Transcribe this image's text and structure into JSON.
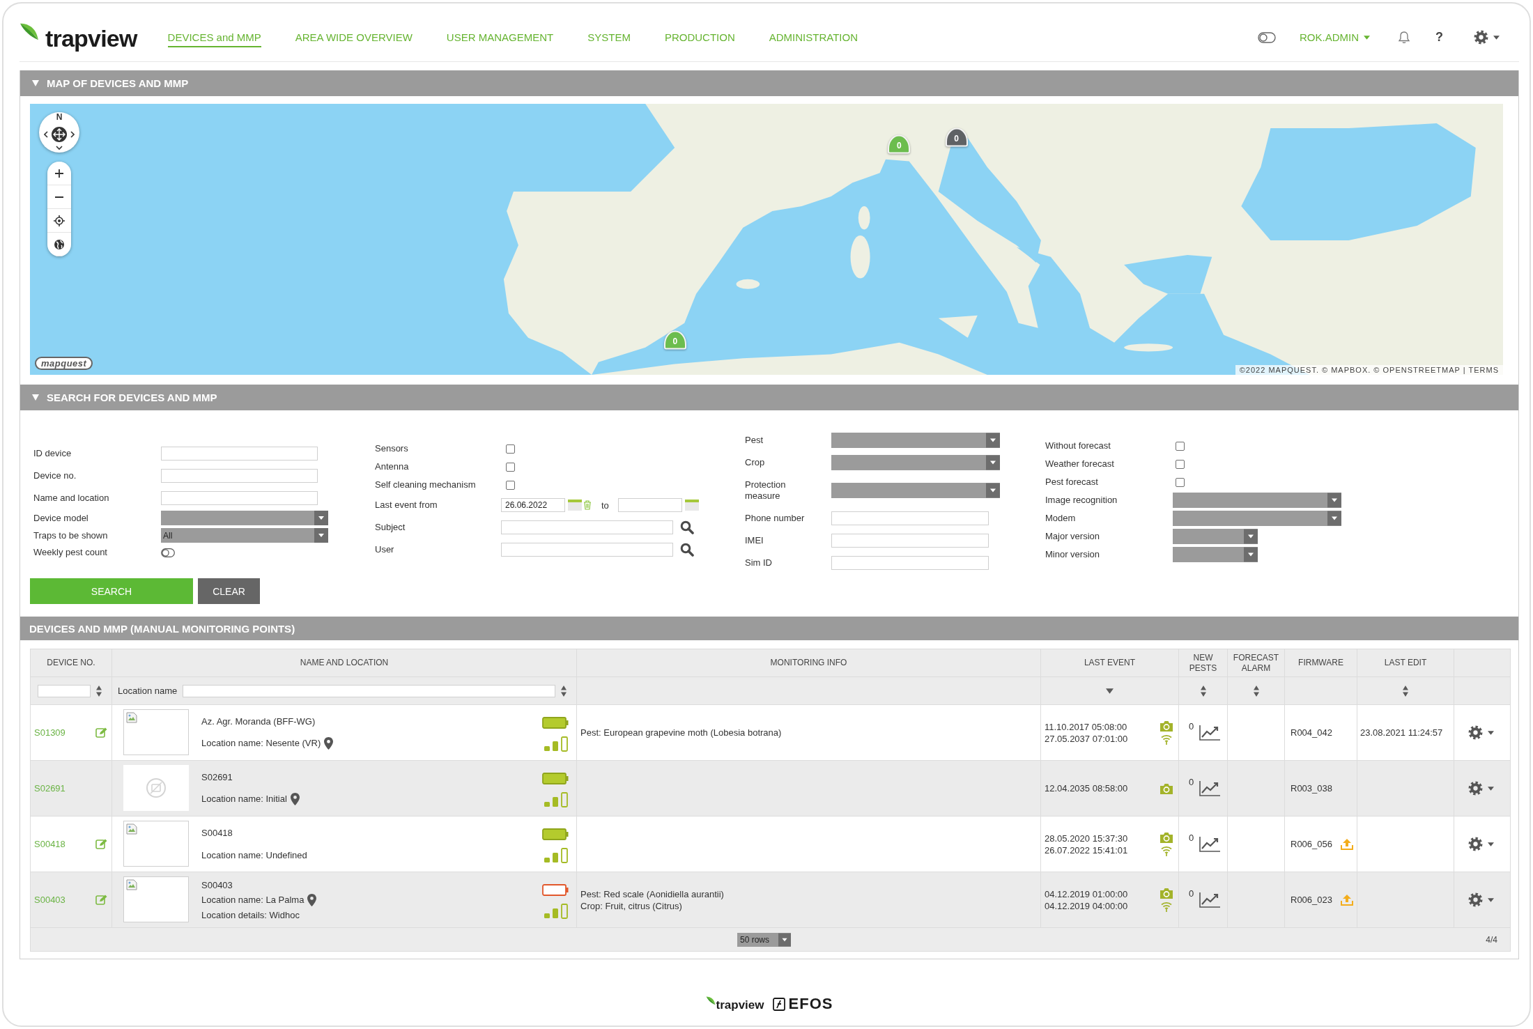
{
  "header": {
    "logo": "trapview",
    "nav": [
      {
        "label": "DEVICES and MMP",
        "selected": true
      },
      {
        "label": "AREA WIDE OVERVIEW",
        "selected": false
      },
      {
        "label": "USER MANAGEMENT",
        "selected": false
      },
      {
        "label": "SYSTEM",
        "selected": false
      },
      {
        "label": "PRODUCTION",
        "selected": false
      },
      {
        "label": "ADMINISTRATION",
        "selected": false
      }
    ],
    "user": "ROK.ADMIN",
    "help": "?"
  },
  "map_panel": {
    "title": "MAP OF DEVICES AND MMP",
    "expanded": true,
    "compass_label": "N",
    "markers": [
      {
        "count": "0",
        "color": "#6cbd4e"
      },
      {
        "count": "0",
        "color": "#5f6265"
      },
      {
        "count": "0",
        "color": "#6cbd4e"
      }
    ],
    "logo": "mapquest",
    "attribution": "©2022 MAPQUEST. © MAPBOX. © OPENSTREETMAP | TERMS"
  },
  "search_panel": {
    "title": "SEARCH FOR DEVICES AND MMP",
    "expanded": true,
    "columns": [
      [
        {
          "label": "ID device",
          "kind": "text"
        },
        {
          "label": "Device no.",
          "kind": "text"
        },
        {
          "label": "Name and location",
          "kind": "text"
        },
        {
          "label": "Device model",
          "kind": "select"
        },
        {
          "label": "Traps to be shown",
          "kind": "select",
          "value": "All"
        },
        {
          "label": "Weekly pest count",
          "kind": "toggle",
          "on": false
        }
      ],
      [
        {
          "label": "Sensors",
          "kind": "checkbox",
          "checked": false
        },
        {
          "label": "Antenna",
          "kind": "checkbox",
          "checked": false
        },
        {
          "label": "Self cleaning mechanism",
          "kind": "checkbox",
          "checked": false
        },
        {
          "label": "Last event from",
          "kind": "date_range",
          "value": "26.06.2022",
          "separator": "to"
        },
        {
          "label": "Subject",
          "kind": "search"
        },
        {
          "label": "User",
          "kind": "search"
        }
      ],
      [
        {
          "label": "Pest",
          "kind": "select"
        },
        {
          "label": "Crop",
          "kind": "select"
        },
        {
          "label": "Protection measure",
          "kind": "select"
        },
        {
          "label": "Phone number",
          "kind": "text"
        },
        {
          "label": "IMEI",
          "kind": "text"
        },
        {
          "label": "Sim ID",
          "kind": "text"
        }
      ],
      [
        {
          "label": "Without forecast",
          "kind": "checkbox",
          "checked": false
        },
        {
          "label": "Weather forecast",
          "kind": "checkbox",
          "checked": false
        },
        {
          "label": "Pest forecast",
          "kind": "checkbox",
          "checked": false
        },
        {
          "label": "Image recognition",
          "kind": "select"
        },
        {
          "label": "Modem",
          "kind": "select"
        },
        {
          "label": "Major version",
          "kind": "select_small"
        },
        {
          "label": "Minor version",
          "kind": "select_small"
        }
      ]
    ],
    "buttons": [
      {
        "label": "SEARCH",
        "kind": "primary"
      },
      {
        "label": "CLEAR",
        "kind": "secondary"
      }
    ]
  },
  "devices_panel": {
    "title": "DEVICES AND MMP (MANUAL MONITORING POINTS)",
    "table": {
      "columns": [
        {
          "label": "DEVICE NO.",
          "sortable": true,
          "sort_descending": false
        },
        {
          "label": "NAME AND LOCATION",
          "sortable": true,
          "sort_descending": false
        },
        {
          "label": "MONITORING INFO",
          "sortable": false
        },
        {
          "label": "LAST EVENT",
          "sortable": true,
          "sort_descending": true
        },
        {
          "label": "NEW PESTS",
          "sortable": true,
          "sort_descending": false
        },
        {
          "label": "FORECAST ALARM",
          "sortable": true,
          "sort_descending": false
        },
        {
          "label": "FIRMWARE",
          "sortable": false
        },
        {
          "label": "LAST EDIT",
          "sortable": true,
          "sort_descending": false
        }
      ],
      "location_filter_label": "Location name",
      "rows": [
        {
          "device_no": "S01309",
          "editable": true,
          "has_photo": true,
          "name": "Az. Agr. Moranda (BFF-WG)",
          "details": [
            {
              "text": "Location name: Nesente (VR)",
              "pin": true
            }
          ],
          "battery_low": false,
          "monitoring": [
            "Pest: European grapevine moth (Lobesia botrana)"
          ],
          "last_event": [
            "11.10.2017 05:08:00",
            "27.05.2037 07:01:00"
          ],
          "wifi": true,
          "new_pests": "0",
          "firmware": "R004_042",
          "update_available": false,
          "last_edit": "23.08.2021 11:24:57"
        },
        {
          "device_no": "S02691",
          "editable": false,
          "has_photo": false,
          "name": "S02691",
          "details": [
            {
              "text": "Location name: Initial",
              "pin": true
            }
          ],
          "battery_low": false,
          "monitoring": [],
          "last_event": [
            "12.04.2035 08:58:00"
          ],
          "wifi": false,
          "new_pests": "0",
          "firmware": "R003_038",
          "update_available": false
        },
        {
          "device_no": "S00418",
          "editable": true,
          "has_photo": true,
          "name": "S00418",
          "details": [
            {
              "text": "Location name: Undefined",
              "pin": false
            }
          ],
          "battery_low": false,
          "monitoring": [],
          "last_event": [
            "28.05.2020 15:37:30",
            "26.07.2022 15:41:01"
          ],
          "wifi": true,
          "new_pests": "0",
          "firmware": "R006_056",
          "update_available": true
        },
        {
          "device_no": "S00403",
          "editable": true,
          "has_photo": true,
          "name": "S00403",
          "details": [
            {
              "text": "Location name: La Palma",
              "pin": true
            },
            {
              "text": "Location details: Widhoc",
              "pin": false
            }
          ],
          "battery_low": true,
          "monitoring": [
            "Pest: Red scale (Aonidiella aurantii)",
            "Crop: Fruit, citrus (Citrus)"
          ],
          "last_event": [
            "04.12.2019 01:00:00",
            "04.12.2019 04:00:00"
          ],
          "wifi": true,
          "new_pests": "0",
          "firmware": "R006_023",
          "update_available": true
        }
      ],
      "page_size": "50 rows",
      "page_info": "4/4"
    }
  },
  "footer": {
    "logos": [
      {
        "text": "trapview",
        "kind": "leaf"
      },
      {
        "text": "EFOS",
        "kind": "square"
      }
    ]
  }
}
